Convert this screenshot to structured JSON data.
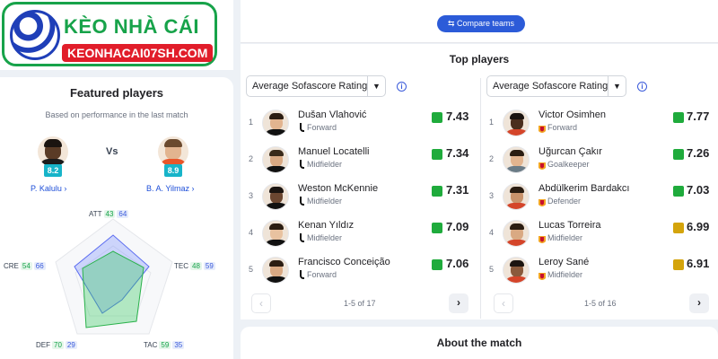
{
  "logo": {
    "title": "KÈO NHÀ CÁI",
    "url": "KEONHACAI07SH.COM"
  },
  "featured": {
    "title": "Featured players",
    "subtitle": "Based on performance in the last match",
    "vs": "Vs",
    "player_a": {
      "name": "P. Kalulu",
      "rating": "8.2"
    },
    "player_b": {
      "name": "B. A. Yilmaz",
      "rating": "8.9"
    },
    "stats": {
      "att": {
        "label": "ATT",
        "a": "43",
        "b": "64"
      },
      "tec": {
        "label": "TEC",
        "a": "48",
        "b": "59"
      },
      "tac": {
        "label": "TAC",
        "a": "59",
        "b": "35"
      },
      "def": {
        "label": "DEF",
        "a": "70",
        "b": "29"
      },
      "cre": {
        "label": "CRE",
        "a": "54",
        "b": "66"
      }
    }
  },
  "compare_button": "Compare teams",
  "top_players": {
    "title": "Top players",
    "left": {
      "dropdown": "Average Sofascore Rating",
      "page_count": "1-5 of 17",
      "players": [
        {
          "rank": "1",
          "name": "Dušan Vlahović",
          "position": "Forward",
          "rating": "7.43",
          "color": "#1fab3c"
        },
        {
          "rank": "2",
          "name": "Manuel Locatelli",
          "position": "Midfielder",
          "rating": "7.34",
          "color": "#1fab3c"
        },
        {
          "rank": "3",
          "name": "Weston McKennie",
          "position": "Midfielder",
          "rating": "7.31",
          "color": "#1fab3c"
        },
        {
          "rank": "4",
          "name": "Kenan Yıldız",
          "position": "Midfielder",
          "rating": "7.09",
          "color": "#1fab3c"
        },
        {
          "rank": "5",
          "name": "Francisco Conceição",
          "position": "Forward",
          "rating": "7.06",
          "color": "#1fab3c"
        }
      ]
    },
    "right": {
      "dropdown": "Average Sofascore Rating",
      "page_count": "1-5 of 16",
      "players": [
        {
          "rank": "1",
          "name": "Victor Osimhen",
          "position": "Forward",
          "rating": "7.77",
          "color": "#1fab3c"
        },
        {
          "rank": "2",
          "name": "Uğurcan Çakır",
          "position": "Goalkeeper",
          "rating": "7.26",
          "color": "#1fab3c"
        },
        {
          "rank": "3",
          "name": "Abdülkerim Bardakcı",
          "position": "Defender",
          "rating": "7.03",
          "color": "#1fab3c"
        },
        {
          "rank": "4",
          "name": "Lucas Torreira",
          "position": "Midfielder",
          "rating": "6.99",
          "color": "#d4a40b"
        },
        {
          "rank": "5",
          "name": "Leroy Sané",
          "position": "Midfielder",
          "rating": "6.91",
          "color": "#d4a40b"
        }
      ]
    }
  },
  "about": {
    "title": "About the match"
  },
  "colors": {
    "accent": "#2c5bd8",
    "green": "#1fab3c",
    "yellow": "#d4a40b",
    "teal": "#17b4c9"
  }
}
